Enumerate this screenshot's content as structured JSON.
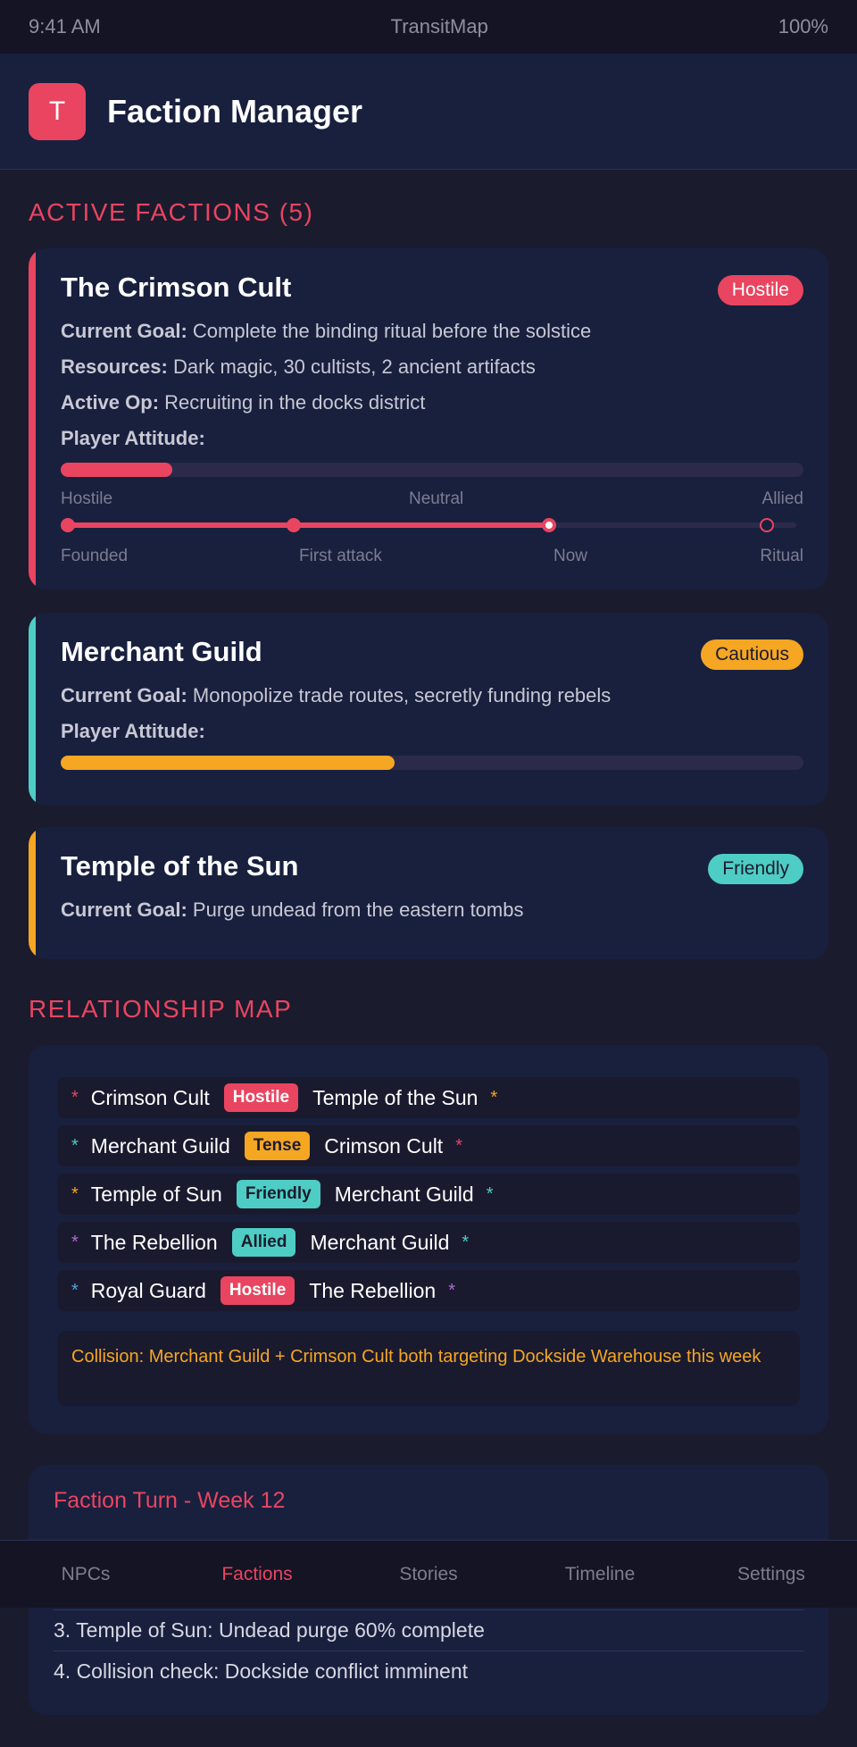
{
  "status_bar": {
    "time": "9:41 AM",
    "carrier": "TransitMap",
    "battery": "100%"
  },
  "header": {
    "icon_letter": "T",
    "title": "Faction Manager"
  },
  "sections": {
    "active_factions": "ACTIVE FACTIONS (5)",
    "relationship_map": "RELATIONSHIP MAP"
  },
  "factions": [
    {
      "name": "The Crimson Cult",
      "status": "Hostile",
      "goal_label": "Current Goal:",
      "goal": "Complete the binding ritual before the solstice",
      "resources_label": "Resources:",
      "resources": "Dark magic, 30 cultists, 2 ancient artifacts",
      "active_op_label": "Active Op:",
      "active_op": "Recruiting in the docks district",
      "attitude_label": "Player Attitude:",
      "attitude_value": 0.15,
      "scale": {
        "low": "Hostile",
        "mid": "Neutral",
        "high": "Allied"
      },
      "timeline": {
        "progress": 0.66,
        "points": [
          {
            "label": "Founded",
            "pos": 0.0
          },
          {
            "label": "First attack",
            "pos": 0.31
          },
          {
            "label": "Now",
            "pos": 0.66
          },
          {
            "label": "Ritual",
            "pos": 0.96
          }
        ]
      },
      "accent": "#e94560"
    },
    {
      "name": "Merchant Guild",
      "status": "Cautious",
      "goal_label": "Current Goal:",
      "goal": "Monopolize trade routes, secretly funding rebels",
      "attitude_label": "Player Attitude:",
      "attitude_value": 0.45,
      "accent": "#4ecdc4"
    },
    {
      "name": "Temple of the Sun",
      "status": "Friendly",
      "goal_label": "Current Goal:",
      "goal": "Purge undead from the eastern tombs",
      "accent": "#f5a623"
    }
  ],
  "relationships": [
    {
      "a": "Crimson Cult",
      "a_color": "#e94560",
      "rel": "Hostile",
      "rel_color": "#e94560",
      "b": "Temple of the Sun",
      "b_color": "#f5a623"
    },
    {
      "a": "Merchant Guild",
      "a_color": "#4ecdc4",
      "rel": "Tense",
      "rel_color": "#f5a623",
      "b": "Crimson Cult",
      "b_color": "#e94560"
    },
    {
      "a": "Temple of Sun",
      "a_color": "#f5a623",
      "rel": "Friendly",
      "rel_color": "#4ecdc4",
      "b": "Merchant Guild",
      "b_color": "#4ecdc4"
    },
    {
      "a": "The Rebellion",
      "a_color": "#b06ad6",
      "rel": "Allied",
      "rel_color": "#4ecdc4",
      "b": "Merchant Guild",
      "b_color": "#4ecdc4"
    },
    {
      "a": "Royal Guard",
      "a_color": "#4fa3e0",
      "rel": "Hostile",
      "rel_color": "#e94560",
      "b": "The Rebellion",
      "b_color": "#b06ad6"
    }
  ],
  "star_glyph": "*",
  "collision": "Collision: Merchant Guild + Crimson Cult both targeting Dockside Warehouse this week",
  "turn": {
    "title": "Faction Turn - Week 12",
    "items": [
      "3. Temple of Sun: Undead purge 60% complete",
      "4. Collision check: Dockside conflict imminent"
    ]
  },
  "tabs": [
    {
      "label": "NPCs",
      "active": false
    },
    {
      "label": "Factions",
      "active": true
    },
    {
      "label": "Stories",
      "active": false
    },
    {
      "label": "Timeline",
      "active": false
    },
    {
      "label": "Settings",
      "active": false
    }
  ],
  "colors": {
    "hostile": "#e94560",
    "cautious": "#f5a623",
    "friendly": "#4ecdc4",
    "track": "#2c2a4a"
  }
}
